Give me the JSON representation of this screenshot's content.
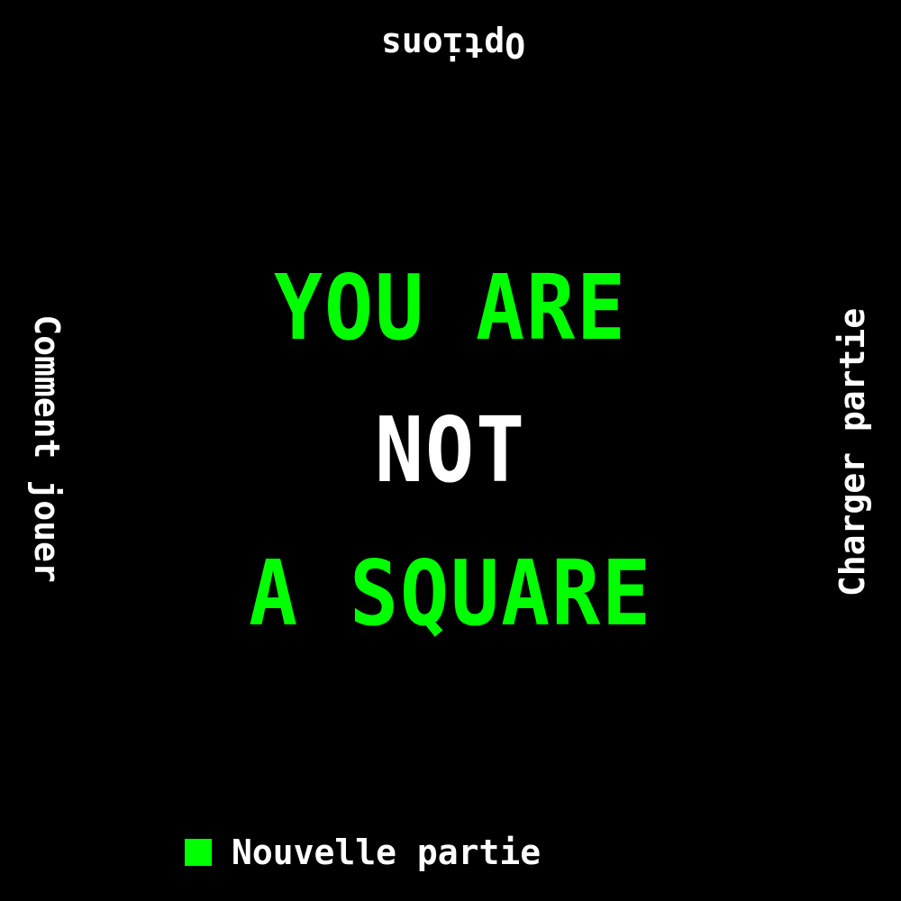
{
  "title": {
    "line1": "YOU ARE",
    "line2": "NOT",
    "line3": "A SQUARE"
  },
  "menu": {
    "top": "Options",
    "left": "Comment jouer",
    "right": "Charger partie",
    "bottom": "Nouvelle partie",
    "selected": "Nouvelle partie"
  },
  "colors": {
    "background": "#000000",
    "accent": "#00ff00",
    "text": "#ffffff"
  },
  "icons": {
    "selection_cursor": "green-square-icon"
  }
}
